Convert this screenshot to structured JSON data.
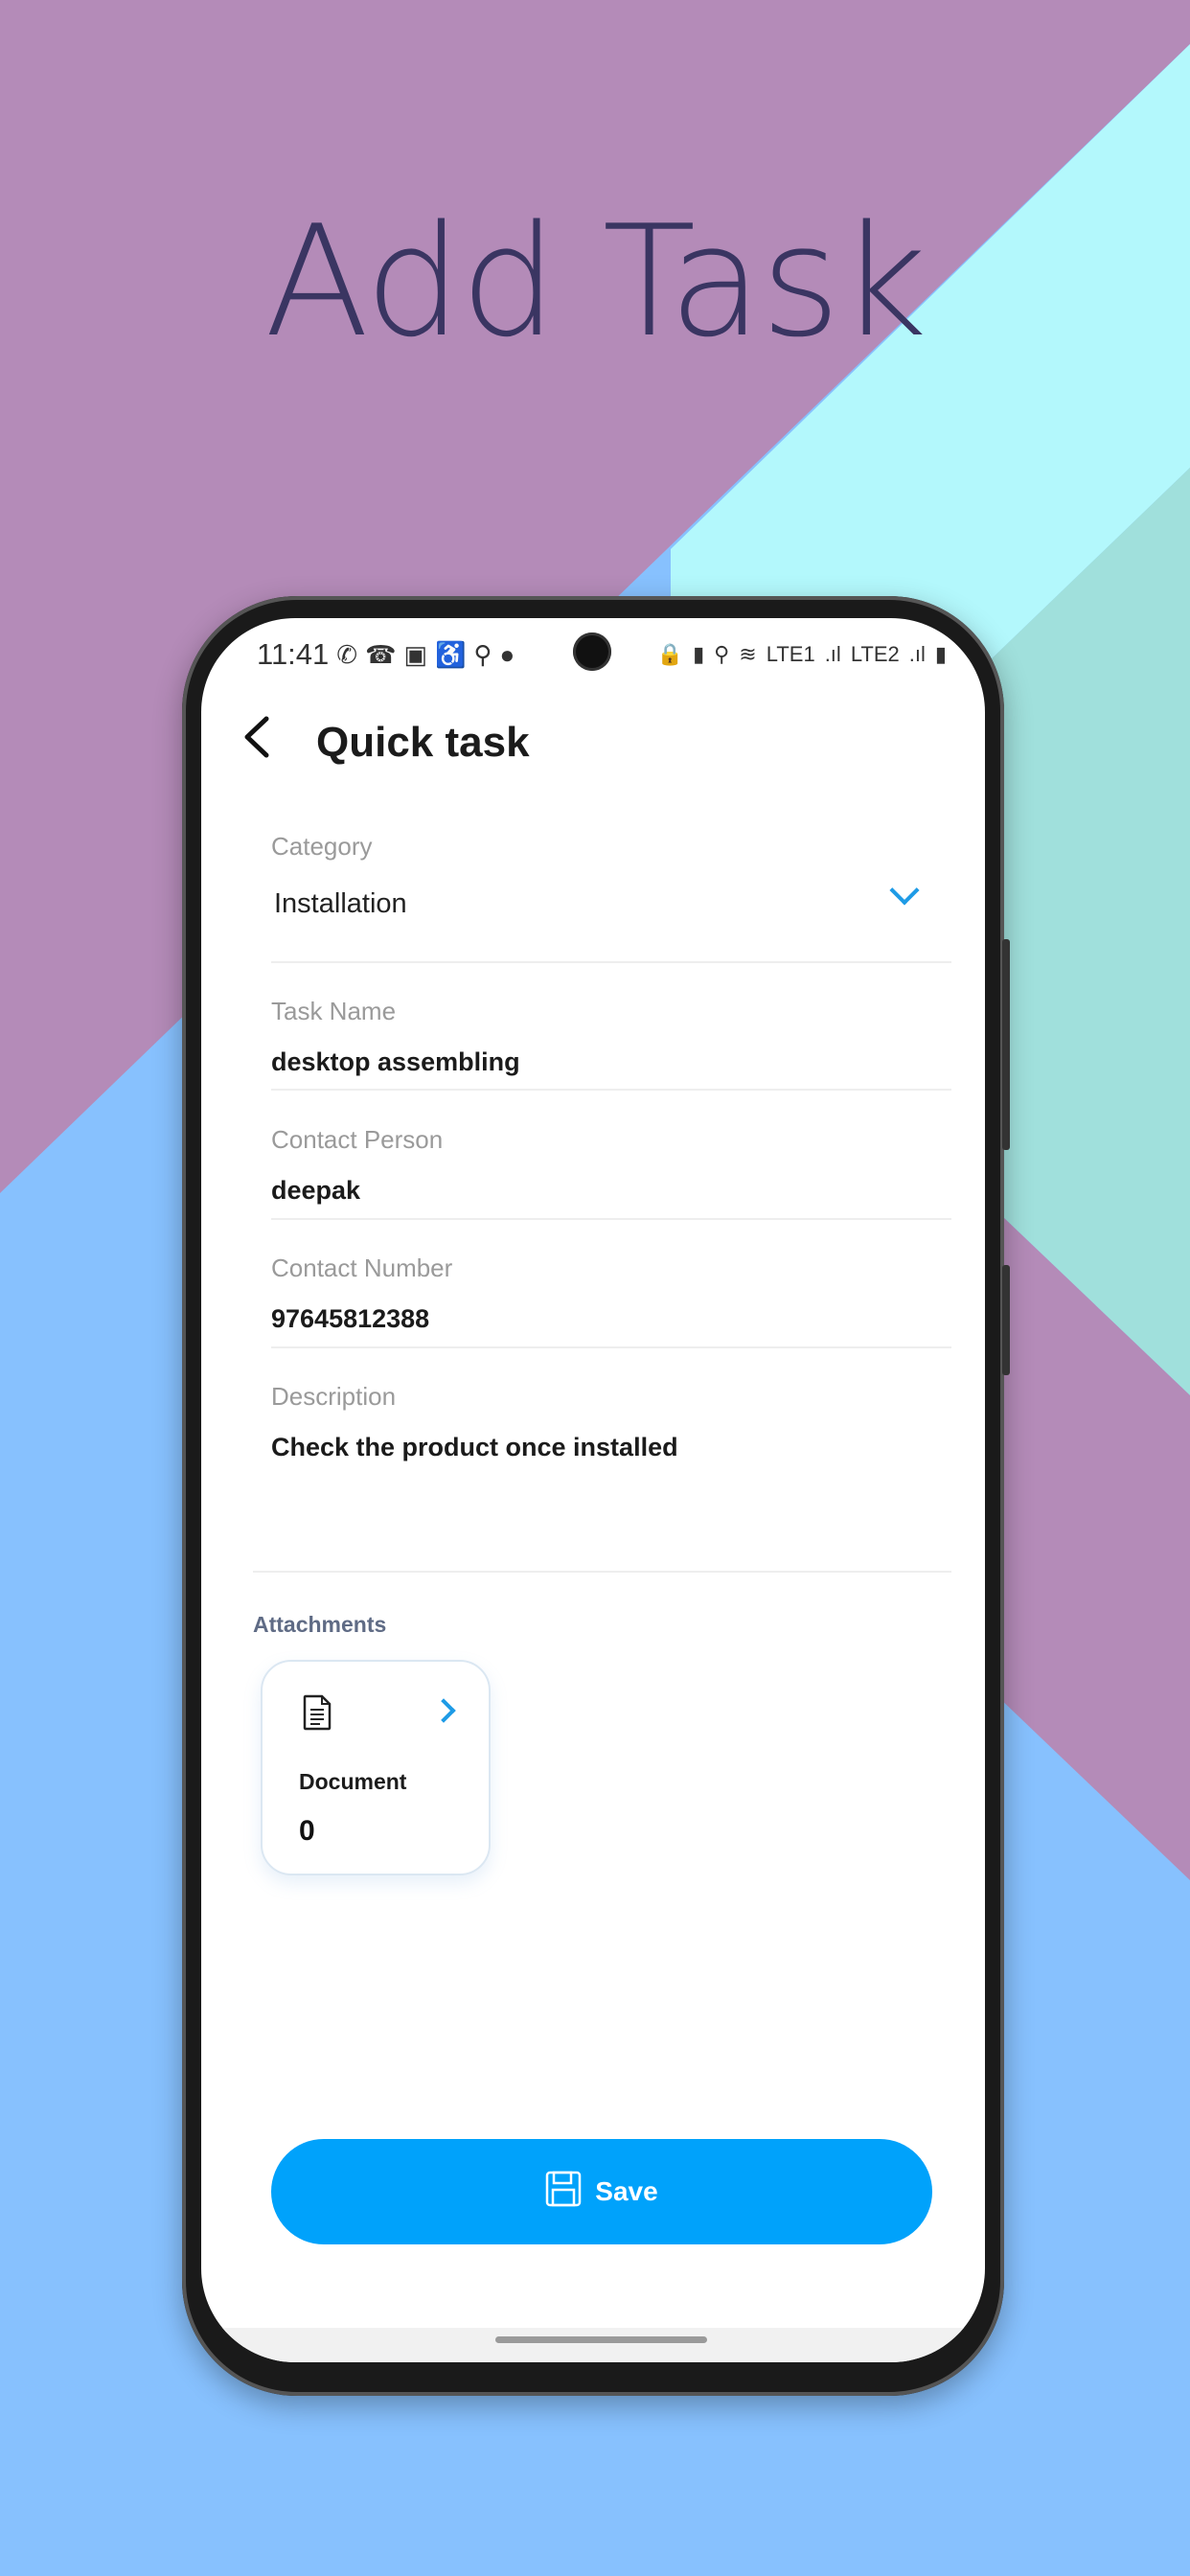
{
  "headline": "Add Task",
  "colors": {
    "bg_purple": "#b48bb8",
    "bg_cyan": "#b3f8fc",
    "bg_teal": "#a0e0dc",
    "bg_blue": "#87c1fe",
    "accent": "#00a2fb",
    "headline": "#3a3562"
  },
  "status_bar": {
    "time": "11:41",
    "left_icons": [
      "whatsapp-icon",
      "phone-icon",
      "facebook-icon",
      "accessibility-icon",
      "location-icon",
      "messenger-icon"
    ],
    "right_icons": [
      "lock-icon",
      "battery-saver-icon",
      "location-icon",
      "wifi-icon",
      "signal-lte1-icon",
      "signal-lte2-icon",
      "battery-icon"
    ],
    "lte1": "LTE1",
    "lte2": "LTE2"
  },
  "header": {
    "title": "Quick task"
  },
  "form": {
    "category": {
      "label": "Category",
      "value": "Installation"
    },
    "task_name": {
      "label": "Task Name",
      "value": "desktop assembling"
    },
    "contact_person": {
      "label": "Contact Person",
      "value": "deepak"
    },
    "contact_number": {
      "label": "Contact Number",
      "value": "97645812388"
    },
    "description": {
      "label": "Description",
      "value": "Check the product once installed"
    }
  },
  "attachments": {
    "label": "Attachments",
    "items": [
      {
        "name": "Document",
        "count": "0",
        "icon": "document-icon"
      }
    ]
  },
  "save_label": "Save"
}
